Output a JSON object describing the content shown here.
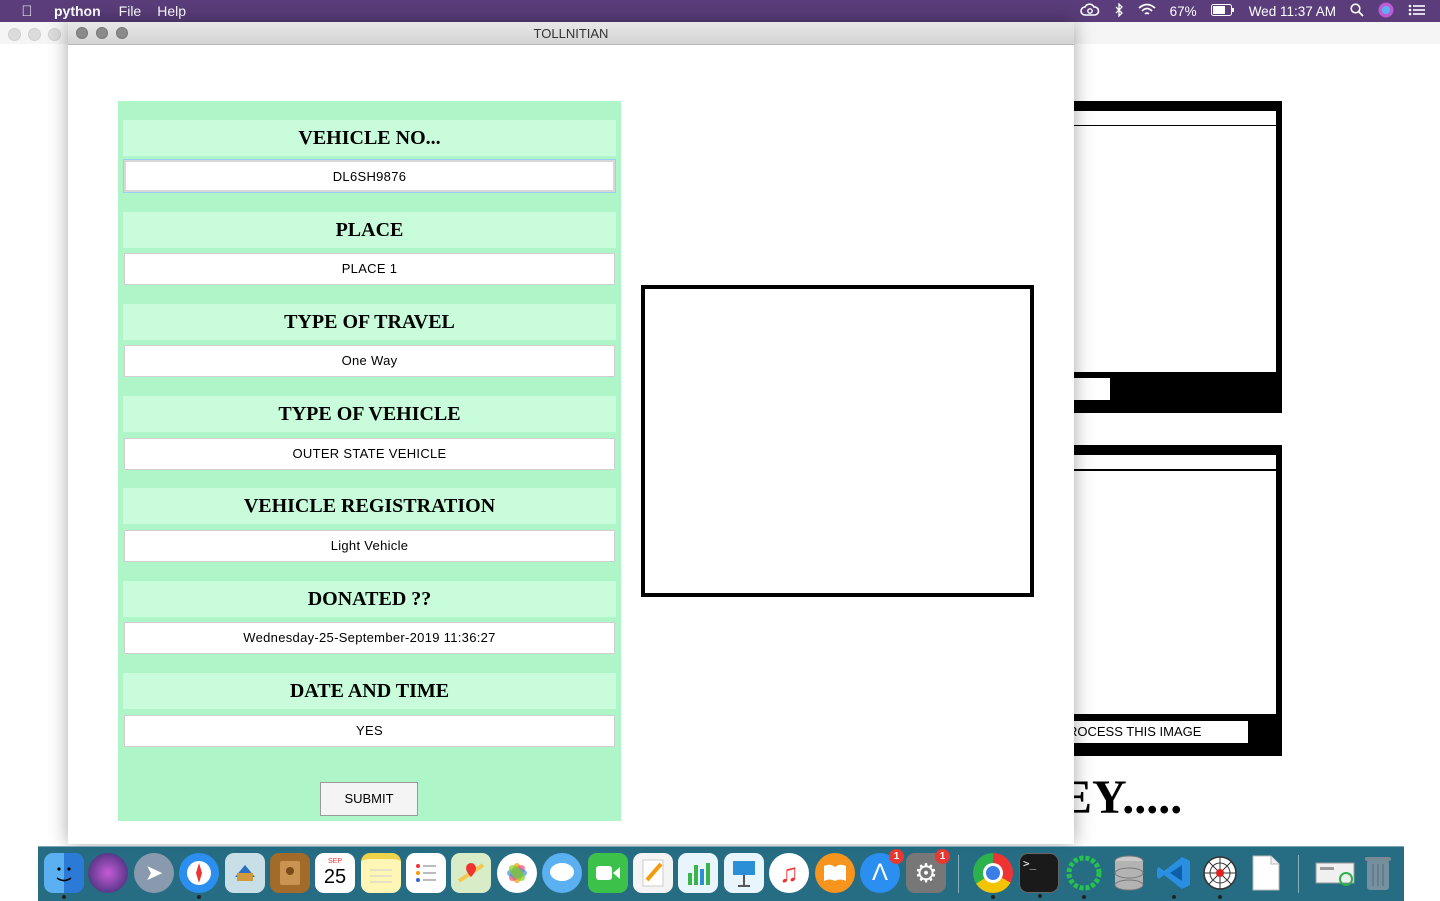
{
  "menubar": {
    "app_name": "python",
    "menus": [
      "File",
      "Help"
    ],
    "battery": "67%",
    "clock": "Wed 11:37 AM"
  },
  "window": {
    "title": "TOLLNITIAN"
  },
  "form": {
    "fields": [
      {
        "label": "VEHICLE NO...",
        "value": "DL6SH9876"
      },
      {
        "label": "PLACE",
        "value": "PLACE 1"
      },
      {
        "label": "TYPE OF TRAVEL",
        "value": "One Way"
      },
      {
        "label": "TYPE OF VEHICLE",
        "value": "OUTER STATE VEHICLE"
      },
      {
        "label": "VEHICLE REGISTRATION",
        "value": "Light Vehicle"
      },
      {
        "label": "DONATED ??",
        "value": "Wednesday-25-September-2019 11:36:27"
      },
      {
        "label": "DATE AND TIME",
        "value": "YES"
      }
    ],
    "submit_label": "SUBMIT"
  },
  "background_window": {
    "process_button": "ROCESS THIS IMAGE",
    "big_text": "EY....."
  },
  "dock": {
    "calendar_month": "SEP",
    "calendar_day": "25",
    "appstore_badge": "1",
    "settings_badge": "1",
    "terminal_prompt": ">_"
  }
}
